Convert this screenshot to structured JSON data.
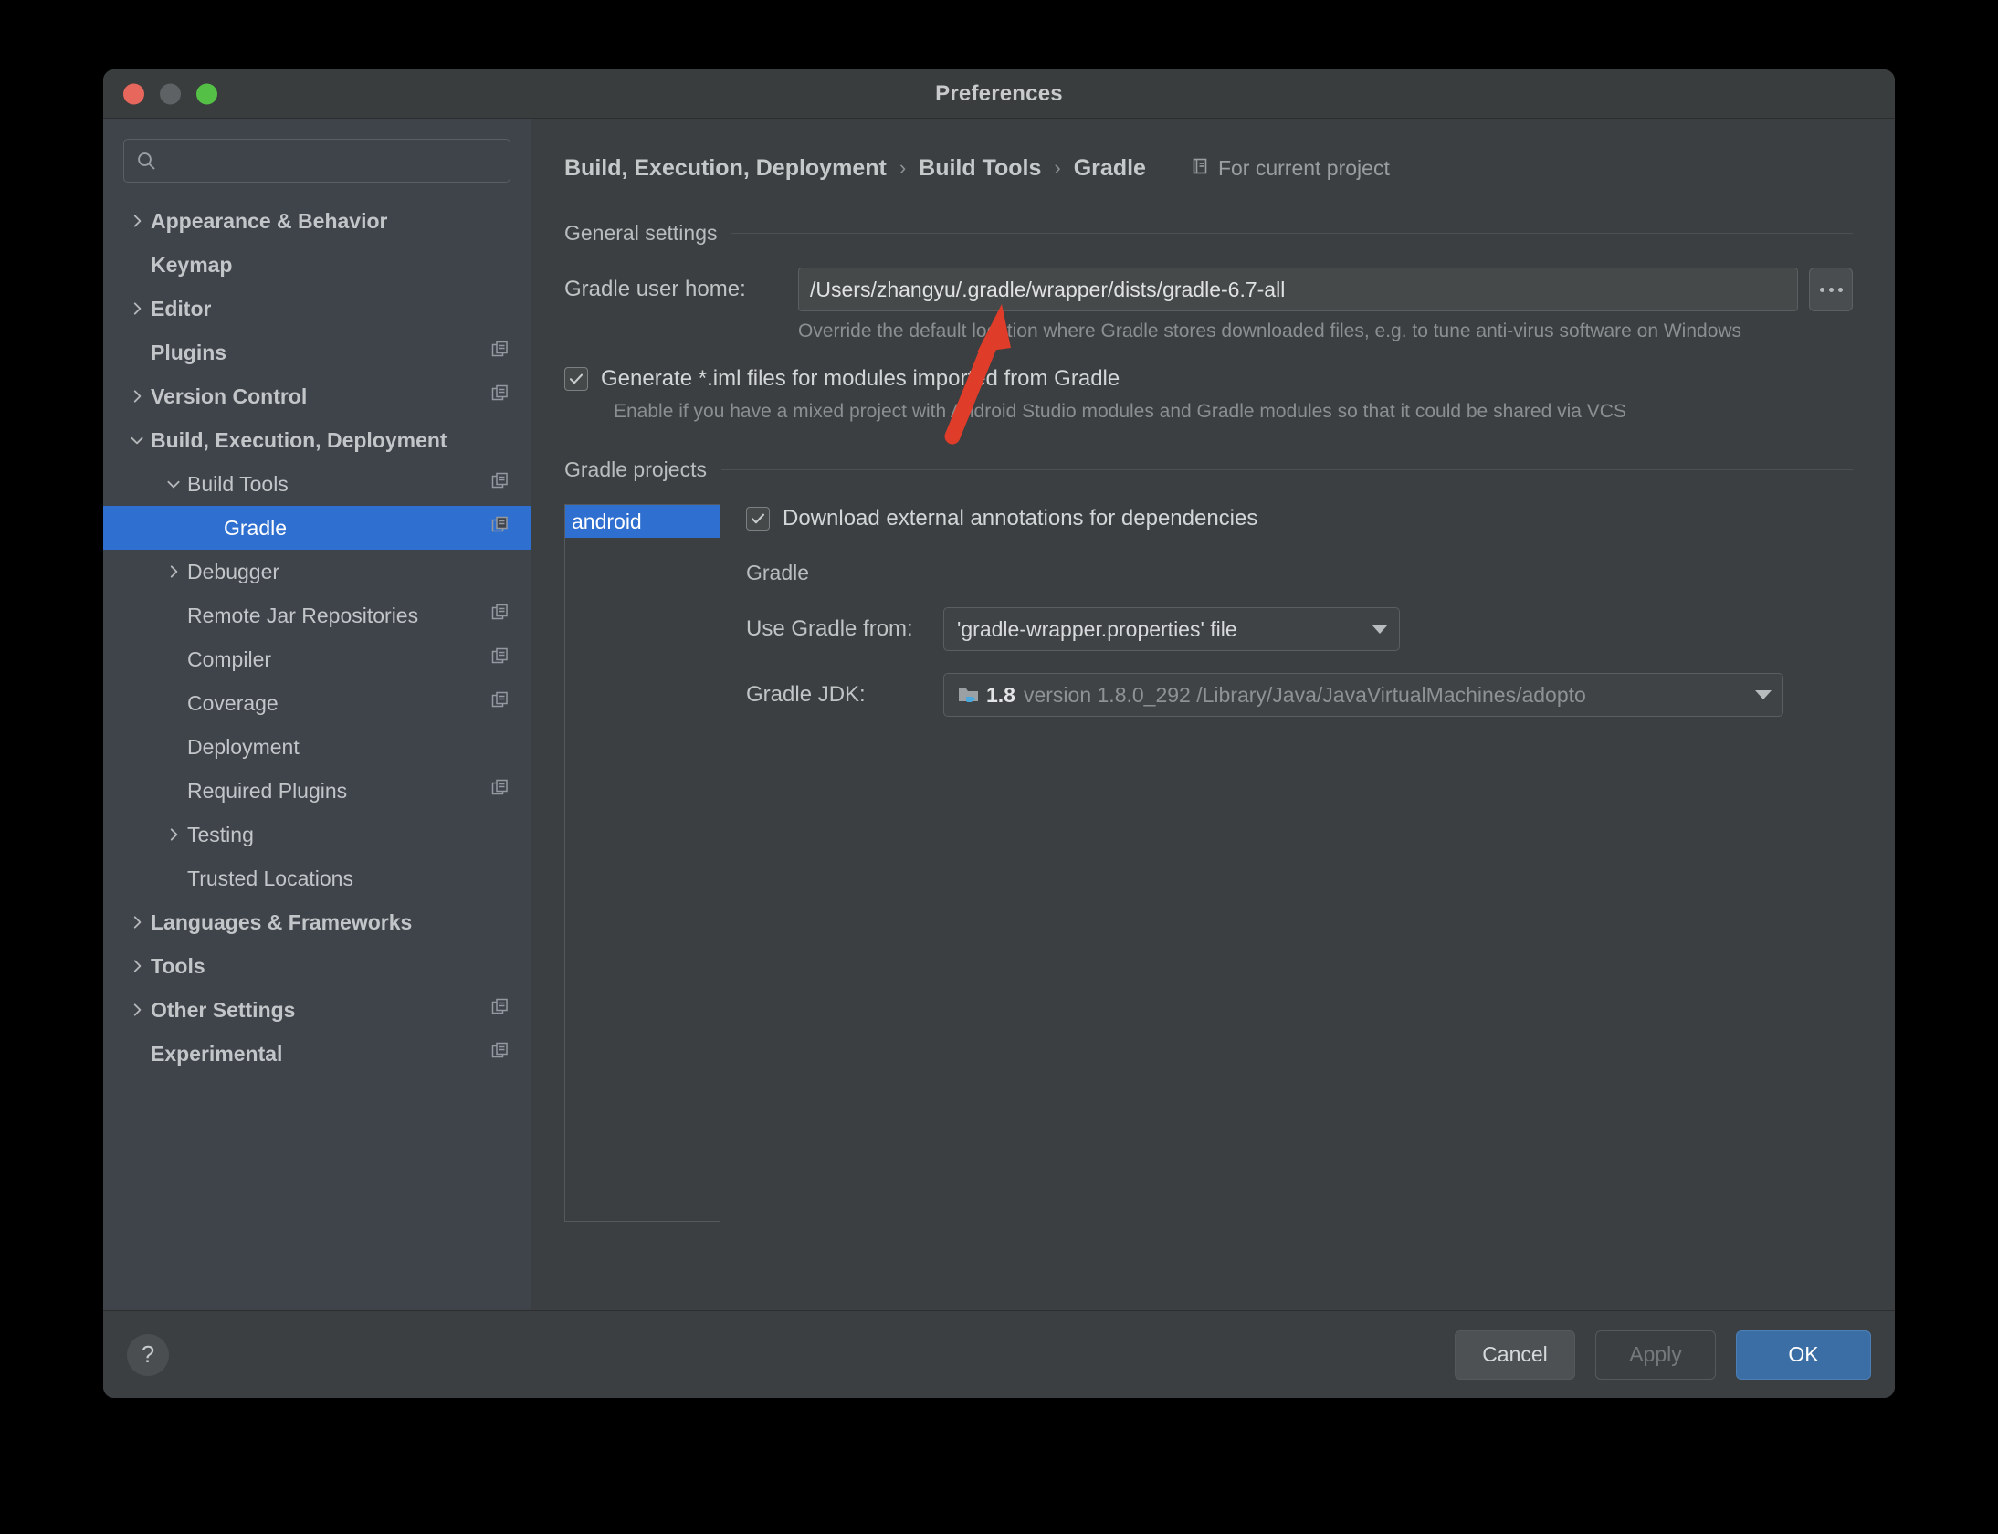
{
  "window": {
    "title": "Preferences",
    "traffic_lights": [
      "close",
      "minimize",
      "zoom"
    ]
  },
  "sidebar": {
    "search": {
      "value": "",
      "placeholder": "",
      "icon": "search-icon"
    },
    "items": [
      {
        "label": "Appearance & Behavior",
        "indent": 0,
        "twisty": "chevron-right",
        "bold": true,
        "copy_icon": false,
        "selected": false
      },
      {
        "label": "Keymap",
        "indent": 0,
        "twisty": "none",
        "bold": true,
        "copy_icon": false,
        "selected": false
      },
      {
        "label": "Editor",
        "indent": 0,
        "twisty": "chevron-right",
        "bold": true,
        "copy_icon": false,
        "selected": false
      },
      {
        "label": "Plugins",
        "indent": 0,
        "twisty": "none",
        "bold": true,
        "copy_icon": true,
        "selected": false
      },
      {
        "label": "Version Control",
        "indent": 0,
        "twisty": "chevron-right",
        "bold": true,
        "copy_icon": true,
        "selected": false
      },
      {
        "label": "Build, Execution, Deployment",
        "indent": 0,
        "twisty": "chevron-down",
        "bold": true,
        "copy_icon": false,
        "selected": false
      },
      {
        "label": "Build Tools",
        "indent": 1,
        "twisty": "chevron-down",
        "bold": false,
        "copy_icon": true,
        "selected": false
      },
      {
        "label": "Gradle",
        "indent": 2,
        "twisty": "none",
        "bold": false,
        "copy_icon": true,
        "selected": true
      },
      {
        "label": "Debugger",
        "indent": 1,
        "twisty": "chevron-right",
        "bold": false,
        "copy_icon": false,
        "selected": false
      },
      {
        "label": "Remote Jar Repositories",
        "indent": 1,
        "twisty": "none",
        "bold": false,
        "copy_icon": true,
        "selected": false
      },
      {
        "label": "Compiler",
        "indent": 1,
        "twisty": "none",
        "bold": false,
        "copy_icon": true,
        "selected": false
      },
      {
        "label": "Coverage",
        "indent": 1,
        "twisty": "none",
        "bold": false,
        "copy_icon": true,
        "selected": false
      },
      {
        "label": "Deployment",
        "indent": 1,
        "twisty": "none",
        "bold": false,
        "copy_icon": false,
        "selected": false
      },
      {
        "label": "Required Plugins",
        "indent": 1,
        "twisty": "none",
        "bold": false,
        "copy_icon": true,
        "selected": false
      },
      {
        "label": "Testing",
        "indent": 1,
        "twisty": "chevron-right",
        "bold": false,
        "copy_icon": false,
        "selected": false
      },
      {
        "label": "Trusted Locations",
        "indent": 1,
        "twisty": "none",
        "bold": false,
        "copy_icon": false,
        "selected": false
      },
      {
        "label": "Languages & Frameworks",
        "indent": 0,
        "twisty": "chevron-right",
        "bold": true,
        "copy_icon": false,
        "selected": false
      },
      {
        "label": "Tools",
        "indent": 0,
        "twisty": "chevron-right",
        "bold": true,
        "copy_icon": false,
        "selected": false
      },
      {
        "label": "Other Settings",
        "indent": 0,
        "twisty": "chevron-right",
        "bold": true,
        "copy_icon": true,
        "selected": false
      },
      {
        "label": "Experimental",
        "indent": 0,
        "twisty": "none",
        "bold": true,
        "copy_icon": true,
        "selected": false
      }
    ]
  },
  "main": {
    "breadcrumb": {
      "parts": [
        "Build, Execution, Deployment",
        "Build Tools",
        "Gradle"
      ],
      "separator": "›"
    },
    "scope": {
      "icon": "project-scope-icon",
      "text": "For current project"
    },
    "general_settings": {
      "section_title": "General settings",
      "gradle_user_home": {
        "label": "Gradle user home:",
        "value": "/Users/zhangyu/.gradle/wrapper/dists/gradle-6.7-all",
        "browse_label": "...",
        "hint": "Override the default location where Gradle stores downloaded files, e.g. to tune anti-virus software on Windows"
      },
      "generate_iml": {
        "label": "Generate *.iml files for modules imported from Gradle",
        "checked": true,
        "hint": "Enable if you have a mixed project with Android Studio modules and Gradle modules so that it could be shared via VCS"
      }
    },
    "gradle_projects": {
      "section_title": "Gradle projects",
      "list": [
        {
          "label": "android",
          "selected": true
        }
      ],
      "download_annotations": {
        "label": "Download external annotations for dependencies",
        "checked": true
      },
      "gradle_sub": {
        "section_title": "Gradle",
        "use_gradle_from": {
          "label": "Use Gradle from:",
          "value": "'gradle-wrapper.properties' file"
        },
        "gradle_jdk": {
          "label": "Gradle JDK:",
          "icon": "jdk-folder-icon",
          "version": "1.8",
          "detail": "version 1.8.0_292 /Library/Java/JavaVirtualMachines/adopto"
        }
      }
    }
  },
  "footer": {
    "help_label": "?",
    "cancel_label": "Cancel",
    "apply_label": "Apply",
    "ok_label": "OK"
  },
  "annotation": {
    "arrow_color": "#e03c2a",
    "type": "pointer-arrow"
  },
  "colors": {
    "accent_selection": "#2f6fd0",
    "ok_button": "#3a6ea5",
    "sidebar_bg": "#3f434a",
    "panel_bg": "#3c3f41",
    "annotation_red": "#e03c2a"
  }
}
